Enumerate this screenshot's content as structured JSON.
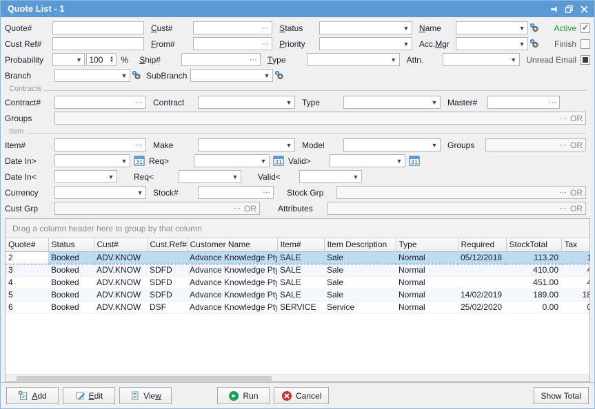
{
  "window": {
    "title": "Quote List - 1",
    "accent": "#5b9bd5",
    "buttons": {
      "pin": "pin-window",
      "restore": "restore-window",
      "close": "close-window"
    }
  },
  "search": {
    "left_col": [
      {
        "label": "Quote#",
        "value": "",
        "kind": "text"
      },
      {
        "label": "Cust Ref#",
        "value": "",
        "kind": "text"
      },
      {
        "label": "Probability",
        "value": "",
        "kind": "combo-spin",
        "spin_value": "100",
        "unit": "%"
      },
      {
        "label": "Branch",
        "value": "",
        "kind": "combo-gear"
      }
    ],
    "mid_col": [
      {
        "label": "Cust#",
        "underline": "C",
        "value": "",
        "kind": "text-ellipsis"
      },
      {
        "label": "From#",
        "underline": "F",
        "value": "",
        "kind": "text-ellipsis"
      },
      {
        "label": "Ship#",
        "underline": "S",
        "value": "",
        "kind": "text-ellipsis"
      },
      {
        "label": "SubBranch",
        "underline": "",
        "value": "",
        "kind": "combo-gear"
      }
    ],
    "right_col": [
      {
        "label": "Status",
        "underline": "S",
        "value": "",
        "kind": "combo"
      },
      {
        "label": "Priority",
        "underline": "P",
        "value": "",
        "kind": "combo"
      },
      {
        "label": "Type",
        "underline": "T",
        "value": "",
        "kind": "combo"
      }
    ],
    "far_col": [
      {
        "label": "Name",
        "underline": "N",
        "value": "",
        "kind": "combo-gear"
      },
      {
        "label": "Acc. Mgr",
        "underline": "M",
        "value": "",
        "kind": "combo-gear"
      },
      {
        "label": "Attn.",
        "underline": "",
        "value": "",
        "kind": "combo"
      }
    ],
    "checks": [
      {
        "label": "Active",
        "state": "checked",
        "label_color": "#23a03c"
      },
      {
        "label": "Finish",
        "state": "unchecked",
        "label_color": "#555555"
      },
      {
        "label": "Unread Email",
        "state": "indeterminate",
        "label_color": "#555555"
      }
    ]
  },
  "contracts": {
    "legend": "Contracts",
    "fields": [
      {
        "label": "Contract#",
        "value": "",
        "kind": "text-ellipsis"
      },
      {
        "label": "Contract",
        "value": "",
        "kind": "combo"
      },
      {
        "label": "Type",
        "value": "",
        "kind": "combo"
      },
      {
        "label": "Master#",
        "value": "",
        "kind": "text-ellipsis"
      }
    ],
    "groups": {
      "label": "Groups",
      "value": "",
      "or_label": "OR"
    }
  },
  "item": {
    "legend": "Item",
    "row1": [
      {
        "label": "Item#",
        "value": "",
        "kind": "text-ellipsis"
      },
      {
        "label": "Make",
        "value": "",
        "kind": "combo"
      },
      {
        "label": "Model",
        "value": "",
        "kind": "combo"
      },
      {
        "label": "Groups",
        "value": "",
        "kind": "gray-or",
        "or_label": "OR"
      }
    ],
    "row2": [
      {
        "label": "Date In>",
        "value": "",
        "kind": "combo-cal"
      },
      {
        "label": "Req>",
        "value": "",
        "kind": "combo-cal"
      },
      {
        "label": "Valid>",
        "value": "",
        "kind": "combo-cal"
      }
    ],
    "row3": [
      {
        "label": "Date In<",
        "value": "",
        "kind": "combo"
      },
      {
        "label": "Req<",
        "value": "",
        "kind": "combo"
      },
      {
        "label": "Valid<",
        "value": "",
        "kind": "combo"
      }
    ],
    "row4": [
      {
        "label": "Currency",
        "value": "",
        "kind": "combo"
      },
      {
        "label": "Stock#",
        "value": "",
        "kind": "text-ellipsis"
      },
      {
        "label": "Stock Grp",
        "value": "",
        "kind": "gray-or",
        "or_label": "OR"
      }
    ],
    "row5": [
      {
        "label": "Cust Grp",
        "value": "",
        "kind": "gray-or",
        "or_label": "OR"
      },
      {
        "label": "Attributes",
        "value": "",
        "kind": "gray-or",
        "or_label": "OR"
      }
    ]
  },
  "grid": {
    "group_hint": "Drag a column header here to group by that column",
    "columns": [
      "Quote#",
      "Status",
      "Cust#",
      "Cust.Ref#",
      "Customer Name",
      "Item#",
      "Item Description",
      "Type",
      "Required",
      "StockTotal",
      "Tax"
    ],
    "rows": [
      {
        "quote": "2",
        "status": "Booked",
        "cust": "ADV.KNOW",
        "custref": "",
        "name": "Advance Knowledge Pty",
        "item": "SALE",
        "desc": "Sale",
        "type": "Normal",
        "required": "05/12/2018",
        "stocktotal": "113.20",
        "tax": "1",
        "selected": true
      },
      {
        "quote": "3",
        "status": "Booked",
        "cust": "ADV.KNOW",
        "custref": "SDFD",
        "name": "Advance Knowledge Pty",
        "item": "SALE",
        "desc": "Sale",
        "type": "Normal",
        "required": "",
        "stocktotal": "410.00",
        "tax": "4",
        "selected": false
      },
      {
        "quote": "4",
        "status": "Booked",
        "cust": "ADV.KNOW",
        "custref": "SDFD",
        "name": "Advance Knowledge Pty",
        "item": "SALE",
        "desc": "Sale",
        "type": "Normal",
        "required": "",
        "stocktotal": "451.00",
        "tax": "4",
        "selected": false
      },
      {
        "quote": "5",
        "status": "Booked",
        "cust": "ADV.KNOW",
        "custref": "SDFD",
        "name": "Advance Knowledge Pty",
        "item": "SALE",
        "desc": "Sale",
        "type": "Normal",
        "required": "14/02/2019",
        "stocktotal": "189.00",
        "tax": "18",
        "selected": false
      },
      {
        "quote": "6",
        "status": "Booked",
        "cust": "ADV.KNOW",
        "custref": "DSF",
        "name": "Advance Knowledge Pty",
        "item": "SERVICE",
        "desc": "Service",
        "type": "Normal",
        "required": "25/02/2020",
        "stocktotal": "0.00",
        "tax": "0",
        "selected": false
      }
    ],
    "status_color": "#1a7a2e",
    "selection_color": "#bcdcf4"
  },
  "footer": {
    "buttons": [
      {
        "id": "add",
        "label": "Add",
        "accel": "A",
        "icon": "add-document-icon"
      },
      {
        "id": "edit",
        "label": "Edit",
        "accel": "E",
        "icon": "edit-pencil-icon"
      },
      {
        "id": "view",
        "label": "View",
        "accel": "w",
        "icon": "document-icon"
      },
      {
        "id": "run",
        "label": "Run",
        "accel": "",
        "icon": "run-arrow-icon"
      },
      {
        "id": "cancel",
        "label": "Cancel",
        "accel": "",
        "icon": "cancel-x-icon"
      }
    ],
    "show_total": "Show Total"
  }
}
